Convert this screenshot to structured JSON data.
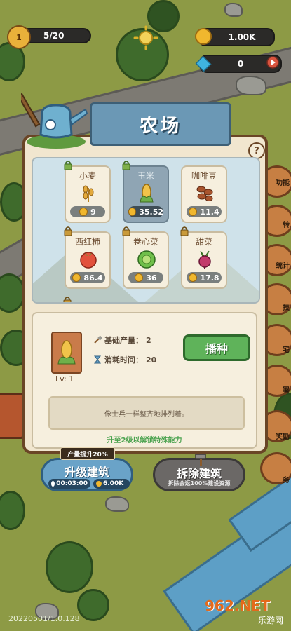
{
  "hud": {
    "level": "1",
    "quest_progress": "5/20",
    "coins": "1.00K",
    "gems": "0"
  },
  "dialog": {
    "title": "农场",
    "help": "?",
    "crops": [
      {
        "name": "小麦",
        "cost": "9",
        "icon": "wheat-icon",
        "locked": true,
        "selected": false
      },
      {
        "name": "玉米",
        "cost": "35.52",
        "icon": "corn-icon",
        "locked": true,
        "selected": true
      },
      {
        "name": "咖啡豆",
        "cost": "11.4",
        "icon": "coffee-bean-icon",
        "locked": false,
        "selected": false
      },
      {
        "name": "西红柿",
        "cost": "86.4",
        "icon": "tomato-icon",
        "locked": true,
        "selected": false
      },
      {
        "name": "卷心菜",
        "cost": "36",
        "icon": "cabbage-icon",
        "locked": true,
        "selected": false
      },
      {
        "name": "甜菜",
        "cost": "17.8",
        "icon": "beet-icon",
        "locked": true,
        "selected": false
      }
    ],
    "detail": {
      "level": "Lv: 1",
      "base_output_label": "基础产量：",
      "base_output_value": "2",
      "time_label": "消耗时间：",
      "time_value": "20",
      "plant_button": "播种",
      "description": "像士兵一样整齐地排列着。",
      "unlock_hint": "升至2级以解锁特殊能力"
    }
  },
  "actions": {
    "upgrade_tag": "产量提升20%",
    "upgrade_label": "升级建筑",
    "upgrade_time": "00:03:00",
    "upgrade_cost": "6.00K",
    "demolish_label": "拆除建筑",
    "demolish_sub": "拆除会返100%建设资源"
  },
  "side_menu": [
    "功能",
    "转",
    "统计",
    "技",
    "宅",
    "署",
    "奖励",
    "务"
  ],
  "version": "20220501/1.0.128",
  "watermark": {
    "top": "962.NET",
    "bottom": "乐游网"
  },
  "colors": {
    "panel": "#f1e6cf",
    "ribbon": "#6b98b5",
    "plant": "#5fb35a",
    "unlock": "#4aa24e"
  }
}
